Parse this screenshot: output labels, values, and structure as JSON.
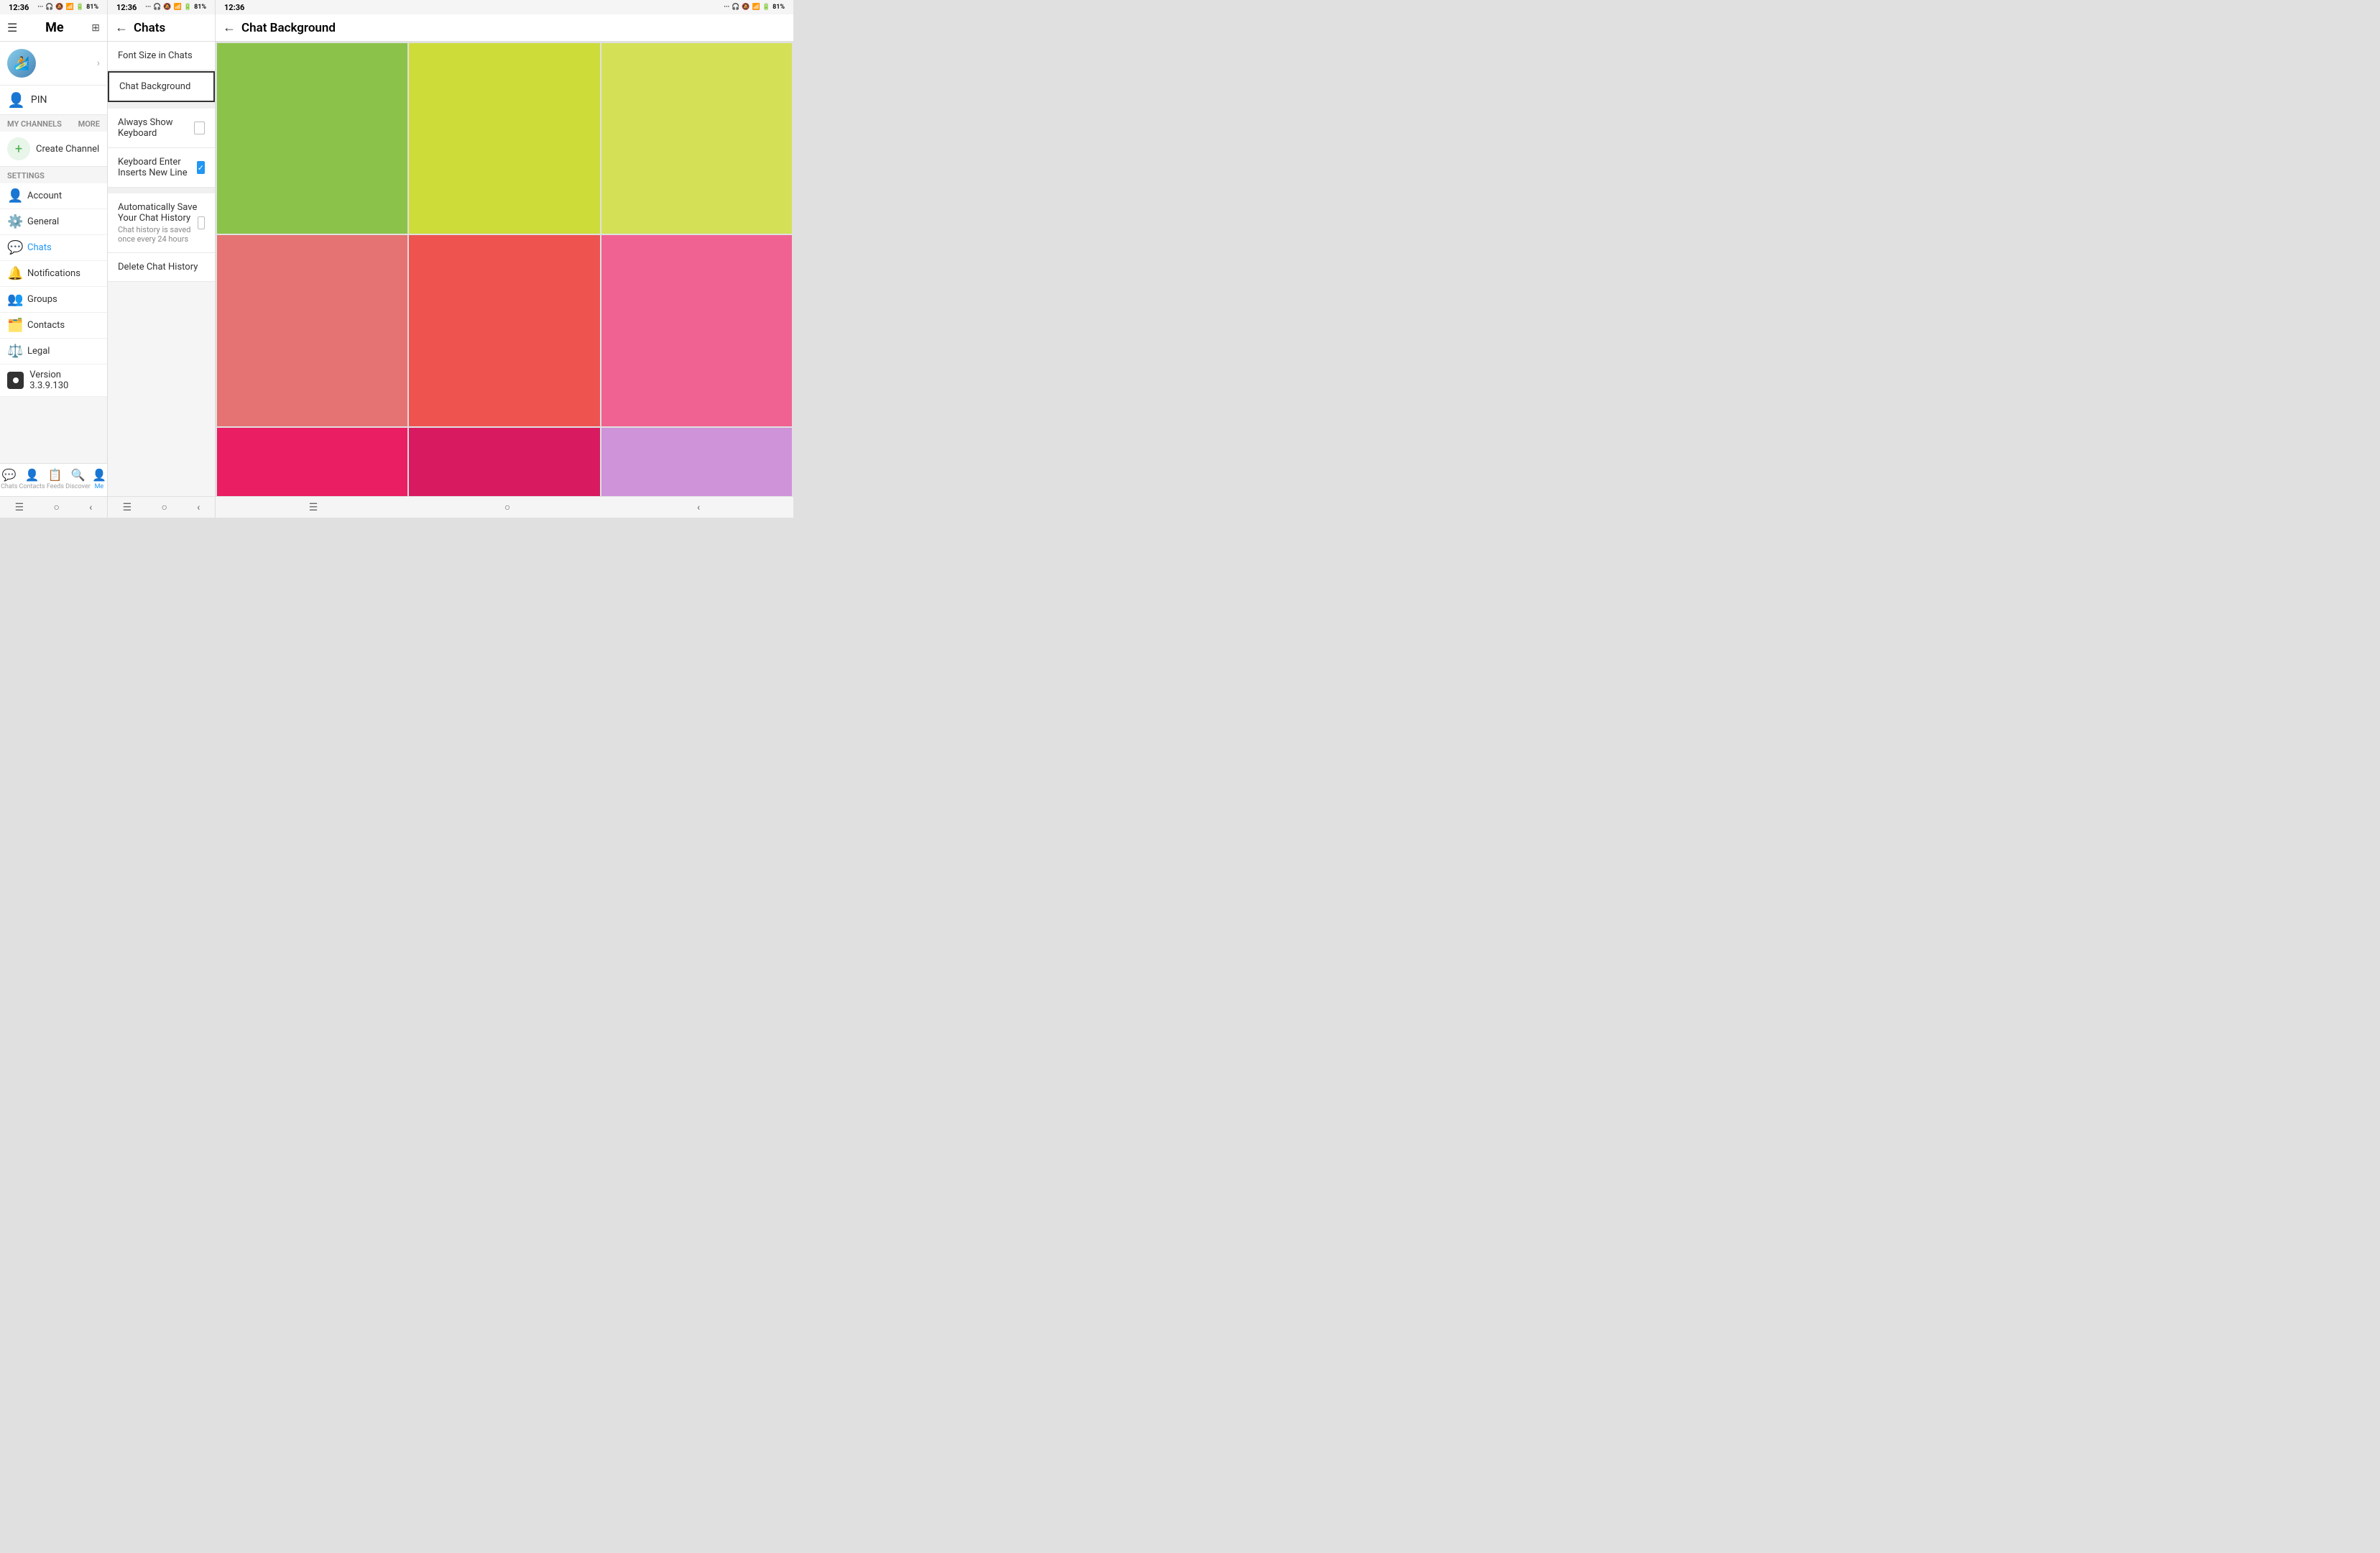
{
  "time": "12:36",
  "battery": "81%",
  "panel1": {
    "title": "Me",
    "pin_label": "PIN",
    "my_channels": "MY CHANNELS",
    "more": "MORE",
    "create_channel": "Create Channel",
    "settings_header": "SETTINGS",
    "settings_items": [
      {
        "label": "Account",
        "icon": "👤"
      },
      {
        "label": "General",
        "icon": "⚙️"
      },
      {
        "label": "Chats",
        "icon": "💬",
        "active": true
      },
      {
        "label": "Notifications",
        "icon": "🔔"
      },
      {
        "label": "Groups",
        "icon": "👥"
      },
      {
        "label": "Contacts",
        "icon": "👤"
      },
      {
        "label": "Legal",
        "icon": "⚖️"
      },
      {
        "label": "Version 3.3.9.130",
        "icon": "📱",
        "is_version": true
      }
    ],
    "nav_items": [
      {
        "label": "Chats",
        "icon": "💬"
      },
      {
        "label": "Contacts",
        "icon": "👤"
      },
      {
        "label": "Feeds",
        "icon": "📋"
      },
      {
        "label": "Discover",
        "icon": "🔍"
      },
      {
        "label": "Me",
        "icon": "👤",
        "active": true
      }
    ]
  },
  "panel2": {
    "title": "Chats",
    "items": [
      {
        "label": "Font Size in Chats",
        "type": "link"
      },
      {
        "label": "Chat Background",
        "type": "link",
        "highlighted": true
      },
      {
        "label": "Always Show Keyboard",
        "type": "checkbox",
        "checked": false
      },
      {
        "label": "Keyboard Enter Inserts New Line",
        "type": "checkbox",
        "checked": true
      },
      {
        "label": "Automatically Save Your Chat History",
        "subtitle": "Chat history is saved once every 24 hours",
        "type": "checkbox",
        "checked": false
      },
      {
        "label": "Delete Chat History",
        "type": "danger"
      }
    ]
  },
  "panel3": {
    "title": "Chat Background",
    "colors": [
      {
        "color": "#8bc34a",
        "selected": false
      },
      {
        "color": "#cddc39",
        "selected": false
      },
      {
        "color": "#d4e157",
        "selected": false
      },
      {
        "color": "#e57373",
        "selected": false
      },
      {
        "color": "#ef5350",
        "selected": false
      },
      {
        "color": "#f06292",
        "selected": false
      },
      {
        "color": "#e91e63",
        "selected": false
      },
      {
        "color": "#d81b60",
        "selected": false
      },
      {
        "color": "#ce93d8",
        "selected": false
      },
      {
        "color": "#ba68c8",
        "selected": false
      },
      {
        "color": "#ab47bc",
        "selected": false
      },
      {
        "color": "#b39ddb",
        "selected": true
      },
      {
        "color": "#7986cb",
        "selected": false
      },
      {
        "color": "#5c6bc0",
        "selected": false
      },
      {
        "color": "#ffb74d",
        "selected": false
      },
      {
        "color": "#ffca28",
        "selected": false
      },
      {
        "color": "#ff8a65",
        "selected": false
      },
      {
        "color": "#a1887f",
        "selected": false
      },
      {
        "color": "#90a4ae",
        "selected": false
      }
    ]
  }
}
